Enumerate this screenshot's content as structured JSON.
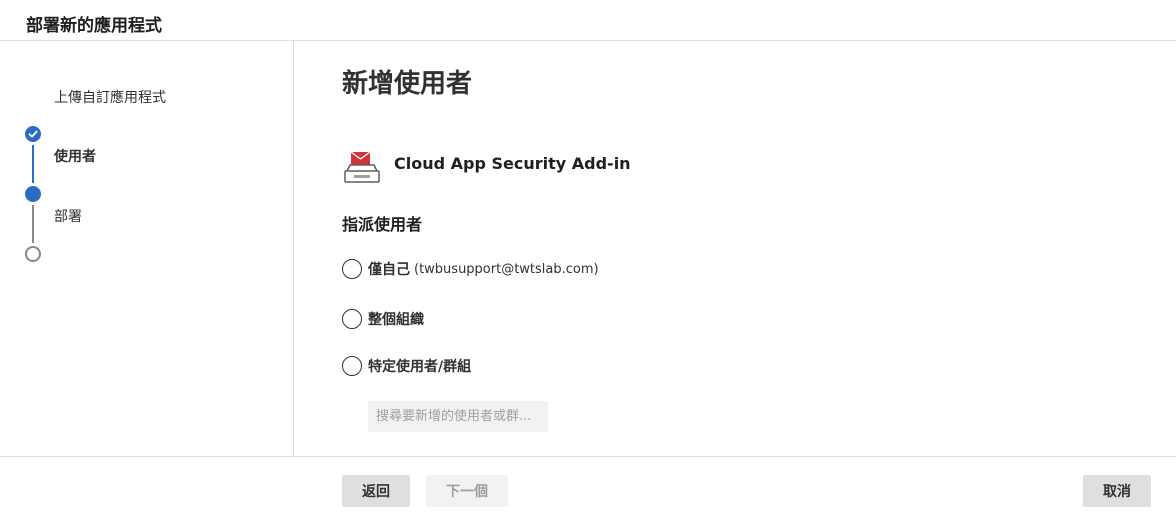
{
  "header": {
    "title": "部署新的應用程式"
  },
  "steps": [
    {
      "label": "上傳自訂應用程式",
      "state": "complete"
    },
    {
      "label": "使用者",
      "state": "current"
    },
    {
      "label": "部署",
      "state": "pending"
    }
  ],
  "main": {
    "title": "新增使用者",
    "app": {
      "name": "Cloud App Security Add-in",
      "icon": "mail-tray-icon"
    },
    "assign_title": "指派使用者",
    "options": [
      {
        "label": "僅自己",
        "detail": "(twbusupport@twtslab.com)",
        "selected": false
      },
      {
        "label": "整個組織",
        "selected": false
      },
      {
        "label": "特定使用者/群組",
        "selected": false
      }
    ],
    "search": {
      "placeholder": "搜尋要新增的使用者或群..."
    }
  },
  "footer": {
    "back_label": "返回",
    "next_label": "下一個",
    "cancel_label": "取消"
  },
  "colors": {
    "accent": "#2b6cc4",
    "icon_red": "#d13438",
    "disabled_bg": "#f3f2f1",
    "button_bg": "#e1dfdd"
  }
}
